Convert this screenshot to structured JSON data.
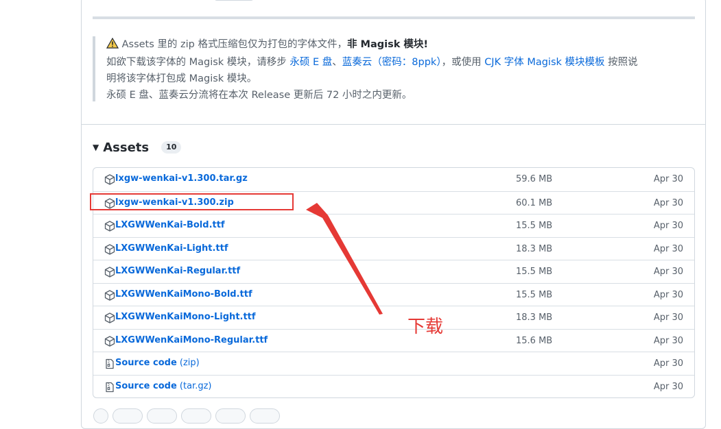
{
  "note": {
    "line1_prefix": "Assets 里的 zip 格式压缩包仅为打包的字体文件，",
    "line1_bold": "非 Magisk 模块!",
    "line2_prefix": "如欲下载该字体的 Magisk 模块，请移步 ",
    "link_yongshuo": "永硕 E 盘",
    "sep1": "、",
    "link_lanzou": "蓝奏云（密码：8ppk）",
    "line2_mid": "，或使用 ",
    "link_template": "CJK 字体 Magisk 模块模板",
    "line2_suffix": " 按照说",
    "line3": "明将该字体打包成 Magisk 模块。",
    "line4": "永硕 E 盘、蓝奏云分流将在本次 Release 更新后 72 小时之内更新。"
  },
  "assets": {
    "title": "Assets",
    "count": "10",
    "rows": [
      {
        "name": "lxgw-wenkai-v1.300.tar.gz",
        "suffix": "",
        "size": "59.6 MB",
        "date": "Apr 30",
        "icon": "package-icon"
      },
      {
        "name": "lxgw-wenkai-v1.300.zip",
        "suffix": "",
        "size": "60.1 MB",
        "date": "Apr 30",
        "icon": "package-icon"
      },
      {
        "name": "LXGWWenKai-Bold.ttf",
        "suffix": "",
        "size": "15.5 MB",
        "date": "Apr 30",
        "icon": "package-icon"
      },
      {
        "name": "LXGWWenKai-Light.ttf",
        "suffix": "",
        "size": "18.3 MB",
        "date": "Apr 30",
        "icon": "package-icon"
      },
      {
        "name": "LXGWWenKai-Regular.ttf",
        "suffix": "",
        "size": "15.5 MB",
        "date": "Apr 30",
        "icon": "package-icon"
      },
      {
        "name": "LXGWWenKaiMono-Bold.ttf",
        "suffix": "",
        "size": "15.5 MB",
        "date": "Apr 30",
        "icon": "package-icon"
      },
      {
        "name": "LXGWWenKaiMono-Light.ttf",
        "suffix": "",
        "size": "18.3 MB",
        "date": "Apr 30",
        "icon": "package-icon"
      },
      {
        "name": "LXGWWenKaiMono-Regular.ttf",
        "suffix": "",
        "size": "15.6 MB",
        "date": "Apr 30",
        "icon": "package-icon"
      },
      {
        "name": "Source code",
        "suffix": " (zip)",
        "size": "",
        "date": "Apr 30",
        "icon": "file-zip-icon"
      },
      {
        "name": "Source code",
        "suffix": " (tar.gz)",
        "size": "",
        "date": "Apr 30",
        "icon": "file-zip-icon"
      }
    ]
  },
  "annotation": {
    "text": "下载",
    "color": "#e53935"
  },
  "colors": {
    "link": "#0969da",
    "muted": "#57606a",
    "border": "#d0d7de"
  }
}
